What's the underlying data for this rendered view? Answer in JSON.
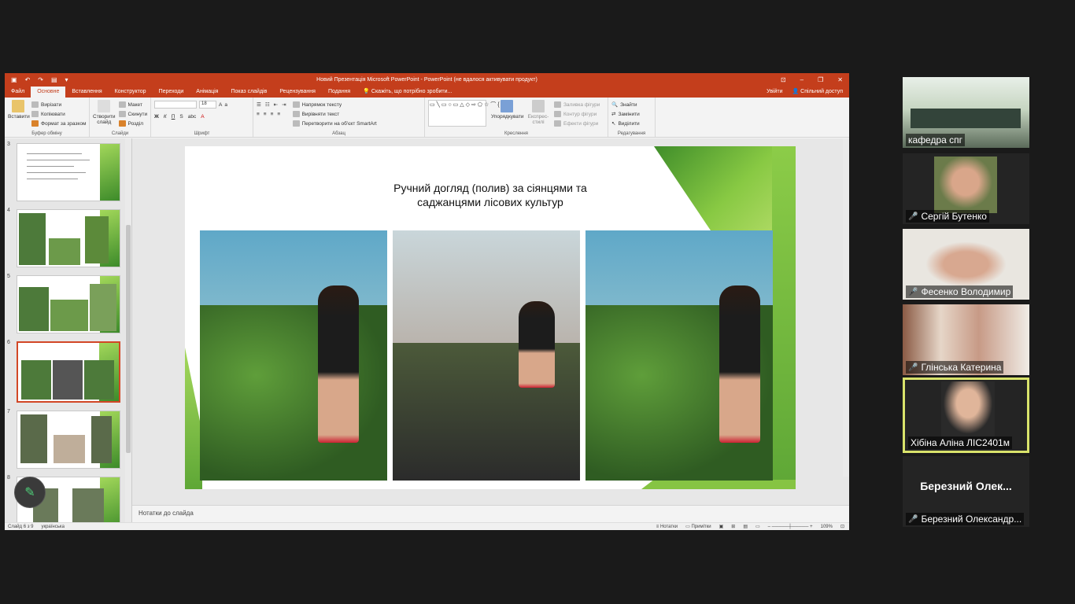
{
  "ppt": {
    "title": "Новий Презентація Microsoft PowerPoint - PowerPoint (не вдалося активувати продукт)",
    "tabs": [
      "Файл",
      "Основне",
      "Вставлення",
      "Конструктор",
      "Переходи",
      "Анімація",
      "Показ слайдів",
      "Рецензування",
      "Подання"
    ],
    "tell_me": "Скажіть, що потрібно зробити...",
    "signin": "Увійти",
    "share": "Спільний доступ",
    "ribbon": {
      "clipboard": {
        "paste": "Вставити",
        "cut": "Вирізати",
        "copy": "Копіювати",
        "format": "Формат за зразком",
        "label": "Буфер обміну"
      },
      "slides": {
        "new": "Створити слайд",
        "layout": "Макет",
        "reset": "Скинути",
        "section": "Розділ",
        "label": "Слайди"
      },
      "font": {
        "size": "18",
        "label": "Шрифт"
      },
      "paragraph": {
        "direction": "Напрямок тексту",
        "align": "Вирівняти текст",
        "smartart": "Перетворити на об'єкт SmartArt",
        "label": "Абзац"
      },
      "drawing": {
        "arrange": "Упорядкувати",
        "styles": "Експрес-стилі",
        "fill": "Заливка фігури",
        "outline": "Контур фігури",
        "effects": "Ефекти фігури",
        "label": "Креслення"
      },
      "editing": {
        "find": "Знайти",
        "replace": "Замінити",
        "select": "Виділити",
        "label": "Редагування"
      }
    },
    "thumb_numbers": [
      "3",
      "4",
      "5",
      "6",
      "7",
      "8"
    ],
    "slide": {
      "title_line1": "Ручний догляд (полив) за сіянцями та",
      "title_line2": "саджанцями лісових культур"
    },
    "notes": "Нотатки до слайда",
    "status": {
      "slide": "Слайд 6 з 9",
      "lang": "українська",
      "notes": "Нотатки",
      "comments": "Примітки",
      "zoom": "109%"
    }
  },
  "participants": [
    {
      "name": "кафедра спг",
      "muted": false
    },
    {
      "name": "Сергій Бутенко",
      "muted": true
    },
    {
      "name": "Фесенко Володимир",
      "muted": true
    },
    {
      "name": "Глінська Катерина",
      "muted": true
    },
    {
      "name": "Хібіна Аліна ЛІС2401м",
      "muted": false
    },
    {
      "name": "Березний Олександр...",
      "muted": true,
      "display": "Березний Олек..."
    }
  ],
  "colors": {
    "accent": "#c43e1c",
    "green": "#86c443",
    "active_speaker": "#d9e36b"
  }
}
